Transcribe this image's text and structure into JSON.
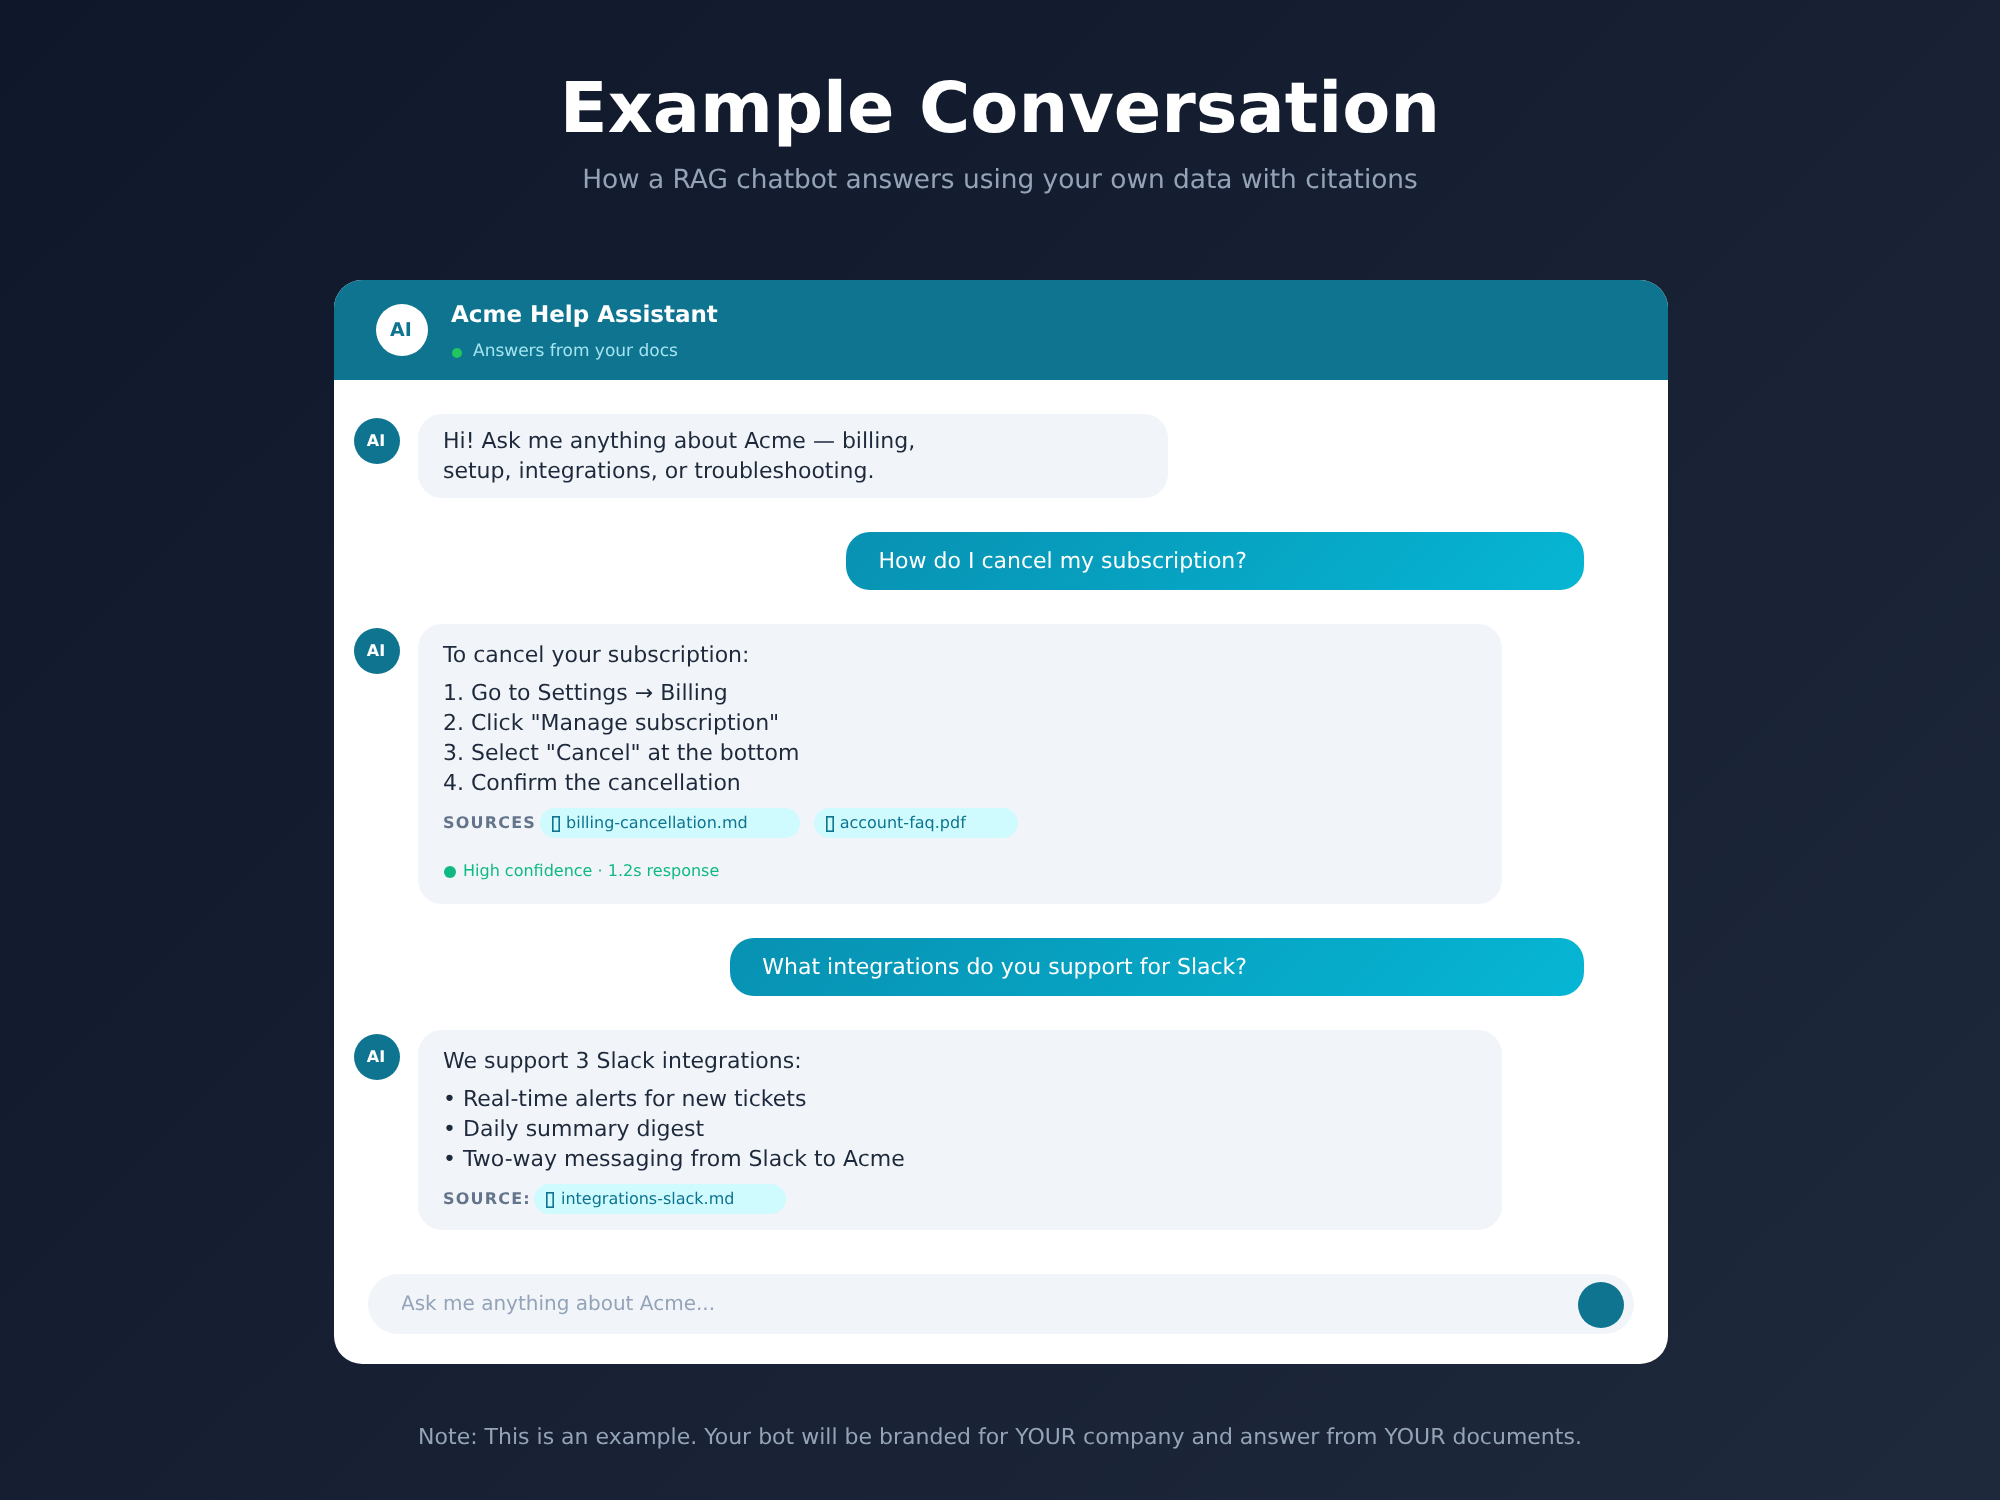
{
  "page": {
    "title": "Example Conversation",
    "subtitle": "How a RAG chatbot answers using your own data with citations"
  },
  "chat": {
    "header": {
      "avatar": "AI",
      "title": "Acme Help Assistant",
      "status": "Answers from your docs"
    },
    "messages": [
      {
        "kind": "bot",
        "avatar": "AI",
        "text": "Hi! Ask me anything about Acme — billing, setup, integrations, or troubleshooting."
      },
      {
        "kind": "user",
        "text": "How do I cancel my subscription?"
      },
      {
        "kind": "bot",
        "avatar": "AI",
        "text": "To cancel your subscription:",
        "list": [
          "1. Go to Settings → Billing",
          "2. Click \"Manage subscription\"",
          "3. Select \"Cancel\" at the bottom",
          "4. Confirm the cancellation"
        ],
        "sources_label": "SOURCES",
        "sources": [
          "billing-cancellation.md",
          "account-faq.pdf"
        ],
        "confidence": "High confidence · 1.2s response"
      },
      {
        "kind": "user",
        "text": "What integrations do you support for Slack?"
      },
      {
        "kind": "bot",
        "avatar": "AI",
        "text": "We support 3 Slack integrations:",
        "list": [
          "• Real-time alerts for new tickets",
          "• Daily summary digest",
          "• Two-way messaging from Slack to Acme"
        ],
        "sources_label": "SOURCE:",
        "sources": [
          "integrations-slack.md"
        ]
      }
    ],
    "input": {
      "placeholder": "Ask me anything about Acme..."
    }
  },
  "footer_note": "Note: This is an example. Your bot will be branded for YOUR company and answer from YOUR documents."
}
